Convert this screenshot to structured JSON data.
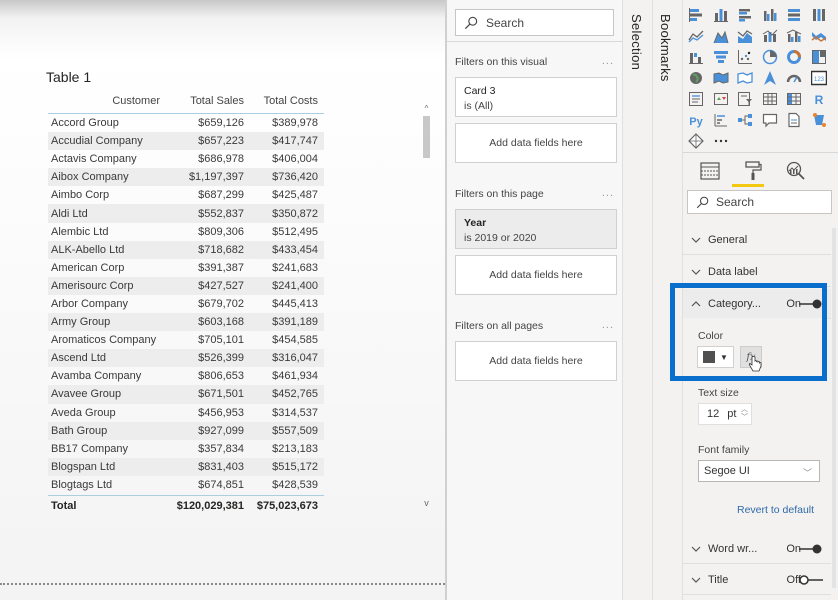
{
  "visual": {
    "title": "Table 1",
    "columns": [
      "Customer",
      "Total Sales",
      "Total Costs"
    ],
    "rows": [
      [
        "Accord Group",
        "$659,126",
        "$389,978"
      ],
      [
        "Accudial Company",
        "$657,223",
        "$417,747"
      ],
      [
        "Actavis Company",
        "$686,978",
        "$406,004"
      ],
      [
        "Aibox Company",
        "$1,197,397",
        "$736,420"
      ],
      [
        "Aimbo Corp",
        "$687,299",
        "$425,487"
      ],
      [
        "Aldi Ltd",
        "$552,837",
        "$350,872"
      ],
      [
        "Alembic Ltd",
        "$809,306",
        "$512,495"
      ],
      [
        "ALK-Abello Ltd",
        "$718,682",
        "$433,454"
      ],
      [
        "American Corp",
        "$391,387",
        "$241,683"
      ],
      [
        "Amerisourc Corp",
        "$427,527",
        "$241,400"
      ],
      [
        "Arbor Company",
        "$679,702",
        "$445,413"
      ],
      [
        "Army Group",
        "$603,168",
        "$391,189"
      ],
      [
        "Aromaticos Company",
        "$705,101",
        "$454,585"
      ],
      [
        "Ascend Ltd",
        "$526,399",
        "$316,047"
      ],
      [
        "Avamba Company",
        "$806,653",
        "$461,934"
      ],
      [
        "Avavee Group",
        "$671,501",
        "$452,765"
      ],
      [
        "Aveda Group",
        "$456,953",
        "$314,537"
      ],
      [
        "Bath Group",
        "$927,099",
        "$557,509"
      ],
      [
        "BB17 Company",
        "$357,834",
        "$213,183"
      ],
      [
        "Blogspan Ltd",
        "$831,403",
        "$515,172"
      ],
      [
        "Blogtags Ltd",
        "$674,851",
        "$428,539"
      ]
    ],
    "total": [
      "Total",
      "$120,029,381",
      "$75,023,673"
    ],
    "scroll_up": "^",
    "scroll_down": "v"
  },
  "filters": {
    "search_placeholder": "Search",
    "visual_section": "Filters on this visual",
    "page_section": "Filters on this page",
    "all_section": "Filters on all pages",
    "more": "...",
    "visual_card": {
      "title": "Card 3",
      "condition": "is (All)"
    },
    "page_card": {
      "title": "Year",
      "condition": "is 2019 or 2020"
    },
    "add_fields": "Add data fields here"
  },
  "side_tabs": {
    "selection": "Selection",
    "bookmarks": "Bookmarks"
  },
  "viz_pane": {
    "icons": [
      "stacked-bar-chart-icon",
      "stacked-column-chart-icon",
      "clustered-bar-chart-icon",
      "clustered-column-chart-icon",
      "100-stacked-bar-chart-icon",
      "100-stacked-column-chart-icon",
      "line-chart-icon",
      "area-chart-icon",
      "stacked-area-chart-icon",
      "line-and-stacked-column-icon",
      "line-and-clustered-column-icon",
      "ribbon-chart-icon",
      "waterfall-chart-icon",
      "funnel-chart-icon",
      "scatter-chart-icon",
      "pie-chart-icon",
      "donut-chart-icon",
      "treemap-icon",
      "map-icon",
      "filled-map-icon",
      "shape-map-icon",
      "azure-map-icon",
      "gauge-icon",
      "card-icon",
      "multi-row-card-icon",
      "kpi-icon",
      "slicer-icon",
      "table-icon",
      "matrix-icon",
      "r-visual-icon",
      "python-visual-icon",
      "key-influencers-icon",
      "decomposition-tree-icon",
      "qa-icon",
      "paginated-report-icon",
      "power-automate-icon",
      "power-apps-icon",
      "more-visuals-icon"
    ],
    "more_label": "...",
    "r_label": "R",
    "py_label": "Py",
    "pane_tabs": [
      "fields-tab",
      "format-tab",
      "analytics-tab"
    ],
    "active_tab": "format-tab",
    "accent": "#f2c811",
    "search_placeholder": "Search"
  },
  "format": {
    "general": "General",
    "data_label": "Data label",
    "category": {
      "label": "Category...",
      "toggle": "On",
      "state": true
    },
    "color_label": "Color",
    "color_value": "#505050",
    "fx_label": "fx",
    "text_size_label": "Text size",
    "text_size_value": "12",
    "text_size_unit": "pt",
    "font_family_label": "Font family",
    "font_family_value": "Segoe UI",
    "revert": "Revert to default",
    "word_wrap": {
      "label": "Word wr...",
      "toggle": "On",
      "state": true
    },
    "title": {
      "label": "Title",
      "toggle": "Off",
      "state": false
    },
    "highlight_color": "#0a6ecc"
  }
}
